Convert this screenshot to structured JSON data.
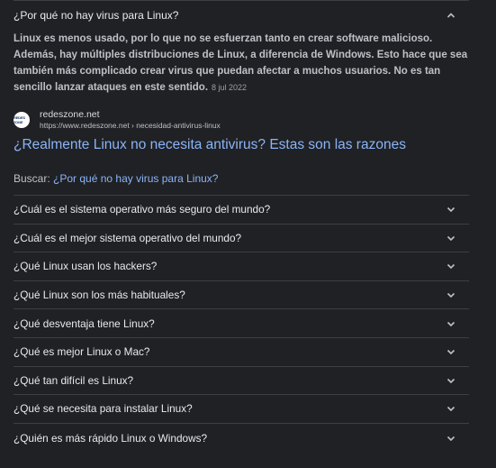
{
  "expanded": {
    "question": "¿Por qué no hay virus para Linux?",
    "answer": "Linux es menos usado, por lo que no se esfuerzan tanto en crear software malicioso. Además, hay múltiples distribuciones de Linux, a diferencia de Windows. Esto hace que sea también más complicado crear virus que puedan afectar a muchos usuarios. No es tan sencillo lanzar ataques en este sentido.",
    "date": "8 jul 2022",
    "source": {
      "favicon_text": "REDES ZONE",
      "name": "redeszone.net",
      "url": "https://www.redeszone.net › necesidad-antivirus-linux"
    },
    "result_title": "¿Realmente Linux no necesita antivirus? Estas son las razones"
  },
  "search": {
    "label": "Buscar:",
    "query": "¿Por qué no hay virus para Linux?"
  },
  "questions": [
    "¿Cuál es el sistema operativo más seguro del mundo?",
    "¿Cuál es el mejor sistema operativo del mundo?",
    "¿Qué Linux usan los hackers?",
    "¿Qué Linux son los más habituales?",
    "¿Qué desventaja tiene Linux?",
    "¿Qué es mejor Linux o Mac?",
    "¿Qué tan difícil es Linux?",
    "¿Qué se necesita para instalar Linux?",
    "¿Quién es más rápido Linux o Windows?"
  ],
  "colors": {
    "background": "#202124",
    "link": "#8ab4f8",
    "text": "#bdc1c6",
    "divider": "#3c4043"
  },
  "icons": {
    "collapse": "chevron-up-icon",
    "expand": "chevron-down-icon"
  }
}
